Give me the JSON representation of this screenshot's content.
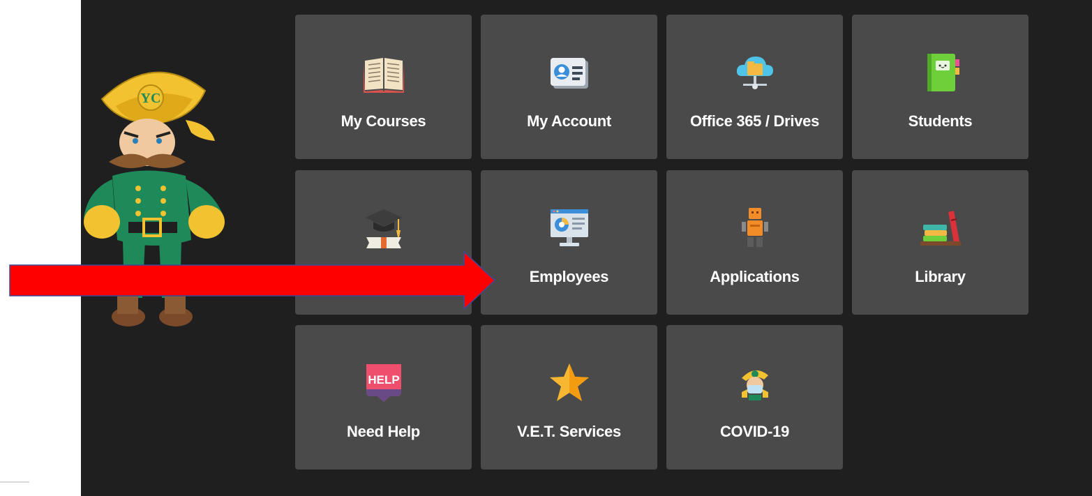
{
  "tiles": [
    {
      "label": "My Courses",
      "icon": "open-book-icon"
    },
    {
      "label": "My Account",
      "icon": "id-card-icon"
    },
    {
      "label": "Office 365 / Drives",
      "icon": "cloud-folder-icon"
    },
    {
      "label": "Students",
      "icon": "notebook-icon"
    },
    {
      "label": "",
      "icon": "graduation-cap-icon"
    },
    {
      "label": "Employees",
      "icon": "monitor-chart-icon"
    },
    {
      "label": "Applications",
      "icon": "robot-icon"
    },
    {
      "label": "Library",
      "icon": "books-stack-icon"
    },
    {
      "label": "Need Help",
      "icon": "help-bubble-icon"
    },
    {
      "label": "V.E.T. Services",
      "icon": "star-icon"
    },
    {
      "label": "COVID-19",
      "icon": "masked-mascot-icon"
    }
  ],
  "mascot": {
    "monogram": "YC"
  },
  "colors": {
    "panel": "#1f1f1f",
    "tile": "#4a4a4a",
    "label": "#ffffff",
    "arrow": "#ff0000",
    "arrow_outline": "#3a4a9a"
  }
}
